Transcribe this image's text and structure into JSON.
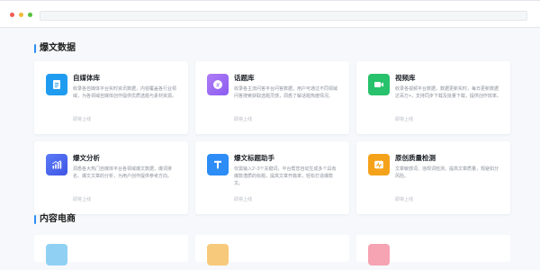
{
  "sections": [
    {
      "title": "爆文数据",
      "cards": [
        {
          "title": "自媒体库",
          "desc": "收录各自媒体平台实时资讯数据，内容覆盖各行业领域，为各领域自媒体创作提供优质选题与素材资源。",
          "footer": "即将上线",
          "icon": "document-icon",
          "color": "#1f9cf0"
        },
        {
          "title": "话题库",
          "desc": "收录各主流问答平台问答数据，用户可通过不同领域问答搜索获取选题灵感，洞悉了解话题热度情况。",
          "footer": "即将上线",
          "icon": "hashtag-icon",
          "color": "#9b6bf2"
        },
        {
          "title": "视频库",
          "desc": "收录各视频平台数据，数据更新实时，每日更新数据达百万+，支持同步下载及批量下载，提供创作效率。",
          "footer": "即将上线",
          "icon": "video-icon",
          "color": "#27c26b"
        },
        {
          "title": "爆文分析",
          "desc": "洞悉各大热门自媒体平台各领域爆文数据，爆词排名、爆文文章的分析，为用户创作提供参考方向。",
          "footer": "即将上线",
          "icon": "chart-icon",
          "color": "#4c68f0"
        },
        {
          "title": "爆文标题助手",
          "desc": "仅需输入2~3个关键词，平台帮您自动生成多个具有爆款潜质的标题，提高文章开篇率，轻松打造爆款文。",
          "footer": "即将上线",
          "icon": "title-t-icon",
          "color": "#2d8cf5"
        },
        {
          "title": "原创质量检测",
          "desc": "文章敏感词、违规词检测，提高文章质量，规避扣分风险。",
          "footer": "即将上线",
          "icon": "quality-check-icon",
          "color": "#f5a21b"
        }
      ]
    },
    {
      "title": "内容电商"
    }
  ]
}
